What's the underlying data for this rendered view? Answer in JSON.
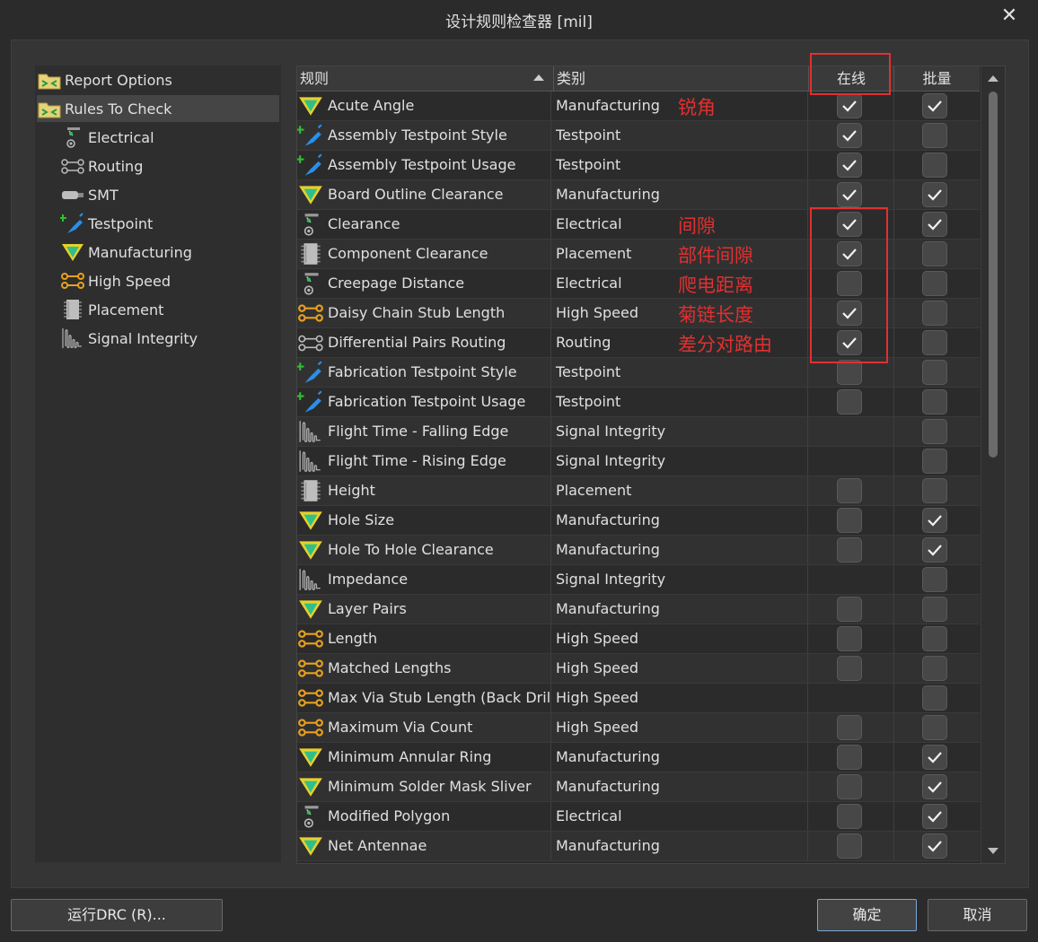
{
  "window": {
    "title": "设计规则检查器 [mil]",
    "close_label": "✕"
  },
  "tree": [
    {
      "label": "Report Options",
      "icon": "folder-icon",
      "level": 0,
      "selected": false
    },
    {
      "label": "Rules To Check",
      "icon": "folder-icon",
      "level": 0,
      "selected": true
    },
    {
      "label": "Electrical",
      "icon": "electrical-icon",
      "level": 1,
      "selected": false
    },
    {
      "label": "Routing",
      "icon": "routing-icon",
      "level": 1,
      "selected": false
    },
    {
      "label": "SMT",
      "icon": "smt-icon",
      "level": 1,
      "selected": false
    },
    {
      "label": "Testpoint",
      "icon": "testpoint-icon",
      "level": 1,
      "selected": false
    },
    {
      "label": "Manufacturing",
      "icon": "manufacturing-icon",
      "level": 1,
      "selected": false
    },
    {
      "label": "High Speed",
      "icon": "highspeed-icon",
      "level": 1,
      "selected": false
    },
    {
      "label": "Placement",
      "icon": "placement-icon",
      "level": 1,
      "selected": false
    },
    {
      "label": "Signal Integrity",
      "icon": "signal-integrity-icon",
      "level": 1,
      "selected": false
    }
  ],
  "grid": {
    "headers": {
      "rule": "规则",
      "category": "类别",
      "online": "在线",
      "batch": "批量"
    },
    "rows": [
      {
        "name": "Acute Angle",
        "category": "Manufacturing",
        "icon": "manufacturing-icon",
        "online": true,
        "batch": true
      },
      {
        "name": "Assembly Testpoint Style",
        "category": "Testpoint",
        "icon": "testpoint-icon",
        "online": true,
        "batch": false
      },
      {
        "name": "Assembly Testpoint Usage",
        "category": "Testpoint",
        "icon": "testpoint-icon",
        "online": true,
        "batch": false
      },
      {
        "name": "Board Outline Clearance",
        "category": "Manufacturing",
        "icon": "manufacturing-icon",
        "online": true,
        "batch": true
      },
      {
        "name": "Clearance",
        "category": "Electrical",
        "icon": "electrical-icon",
        "online": true,
        "batch": true
      },
      {
        "name": "Component Clearance",
        "category": "Placement",
        "icon": "placement-icon",
        "online": true,
        "batch": false
      },
      {
        "name": "Creepage Distance",
        "category": "Electrical",
        "icon": "electrical-icon",
        "online": false,
        "batch": false
      },
      {
        "name": "Daisy Chain Stub Length",
        "category": "High Speed",
        "icon": "highspeed-icon",
        "online": true,
        "batch": false
      },
      {
        "name": "Differential Pairs Routing",
        "category": "Routing",
        "icon": "routing-icon",
        "online": true,
        "batch": false
      },
      {
        "name": "Fabrication Testpoint Style",
        "category": "Testpoint",
        "icon": "testpoint-icon",
        "online": false,
        "batch": false
      },
      {
        "name": "Fabrication Testpoint Usage",
        "category": "Testpoint",
        "icon": "testpoint-icon",
        "online": false,
        "batch": false
      },
      {
        "name": "Flight Time - Falling Edge",
        "category": "Signal Integrity",
        "icon": "signal-integrity-icon",
        "online": null,
        "batch": false
      },
      {
        "name": "Flight Time - Rising Edge",
        "category": "Signal Integrity",
        "icon": "signal-integrity-icon",
        "online": null,
        "batch": false
      },
      {
        "name": "Height",
        "category": "Placement",
        "icon": "placement-icon",
        "online": false,
        "batch": false
      },
      {
        "name": "Hole Size",
        "category": "Manufacturing",
        "icon": "manufacturing-icon",
        "online": false,
        "batch": true
      },
      {
        "name": "Hole To Hole Clearance",
        "category": "Manufacturing",
        "icon": "manufacturing-icon",
        "online": false,
        "batch": true
      },
      {
        "name": "Impedance",
        "category": "Signal Integrity",
        "icon": "signal-integrity-icon",
        "online": null,
        "batch": false
      },
      {
        "name": "Layer Pairs",
        "category": "Manufacturing",
        "icon": "manufacturing-icon",
        "online": false,
        "batch": false
      },
      {
        "name": "Length",
        "category": "High Speed",
        "icon": "highspeed-icon",
        "online": false,
        "batch": false
      },
      {
        "name": "Matched Lengths",
        "category": "High Speed",
        "icon": "highspeed-icon",
        "online": false,
        "batch": false
      },
      {
        "name": "Max Via Stub Length (Back Drilling)",
        "category": "High Speed",
        "icon": "highspeed-icon",
        "online": null,
        "batch": false
      },
      {
        "name": "Maximum Via Count",
        "category": "High Speed",
        "icon": "highspeed-icon",
        "online": false,
        "batch": false
      },
      {
        "name": "Minimum Annular Ring",
        "category": "Manufacturing",
        "icon": "manufacturing-icon",
        "online": false,
        "batch": true
      },
      {
        "name": "Minimum Solder Mask Sliver",
        "category": "Manufacturing",
        "icon": "manufacturing-icon",
        "online": false,
        "batch": true
      },
      {
        "name": "Modified Polygon",
        "category": "Electrical",
        "icon": "electrical-icon",
        "online": false,
        "batch": true
      },
      {
        "name": "Net Antennae",
        "category": "Manufacturing",
        "icon": "manufacturing-icon",
        "online": false,
        "batch": true
      }
    ]
  },
  "annotations": [
    {
      "text": "锐角",
      "row": 0
    },
    {
      "text": "间隙",
      "row": 4
    },
    {
      "text": "部件间隙",
      "row": 5
    },
    {
      "text": "爬电距离",
      "row": 6
    },
    {
      "text": "菊链长度",
      "row": 7
    },
    {
      "text": "差分对路由",
      "row": 8
    }
  ],
  "buttons": {
    "run_drc": "运行DRC (R)...",
    "ok": "确定",
    "cancel": "取消"
  },
  "colors": {
    "annotation_red": "#e03030",
    "accent_border": "#7aa7d8",
    "manufacturing_yellow": "#e8d02a",
    "manufacturing_green": "#2fbf8a",
    "testpoint_blue": "#2a8fe8",
    "highspeed_orange": "#e8a020"
  }
}
